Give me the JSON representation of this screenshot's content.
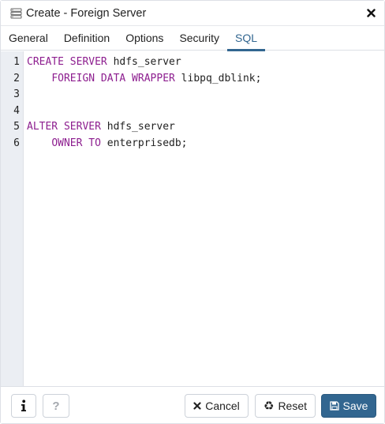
{
  "dialog": {
    "title": "Create - Foreign Server",
    "title_icon": "server-stack-icon",
    "close_icon": "close-icon"
  },
  "tabs": [
    {
      "label": "General",
      "active": false
    },
    {
      "label": "Definition",
      "active": false
    },
    {
      "label": "Options",
      "active": false
    },
    {
      "label": "Security",
      "active": false
    },
    {
      "label": "SQL",
      "active": true
    }
  ],
  "editor": {
    "line_numbers": [
      "1",
      "2",
      "3",
      "4",
      "5",
      "6"
    ],
    "lines": [
      {
        "kw": "CREATE SERVER",
        "indent": "",
        "rest": " hdfs_server"
      },
      {
        "kw": "FOREIGN DATA WRAPPER",
        "indent": "    ",
        "rest": " libpq_dblink;"
      },
      {
        "kw": "",
        "indent": "",
        "rest": ""
      },
      {
        "kw": "",
        "indent": "",
        "rest": ""
      },
      {
        "kw": "ALTER SERVER",
        "indent": "",
        "rest": " hdfs_server"
      },
      {
        "kw": "OWNER TO",
        "indent": "    ",
        "rest": " enterprisedb;"
      }
    ]
  },
  "footer": {
    "info_icon": "info-icon",
    "help_label": "?",
    "cancel_label": "Cancel",
    "reset_label": "Reset",
    "save_label": "Save"
  },
  "colors": {
    "accent": "#326690",
    "keyword": "#8d1e8f",
    "gutter_bg": "#ebeef3"
  }
}
